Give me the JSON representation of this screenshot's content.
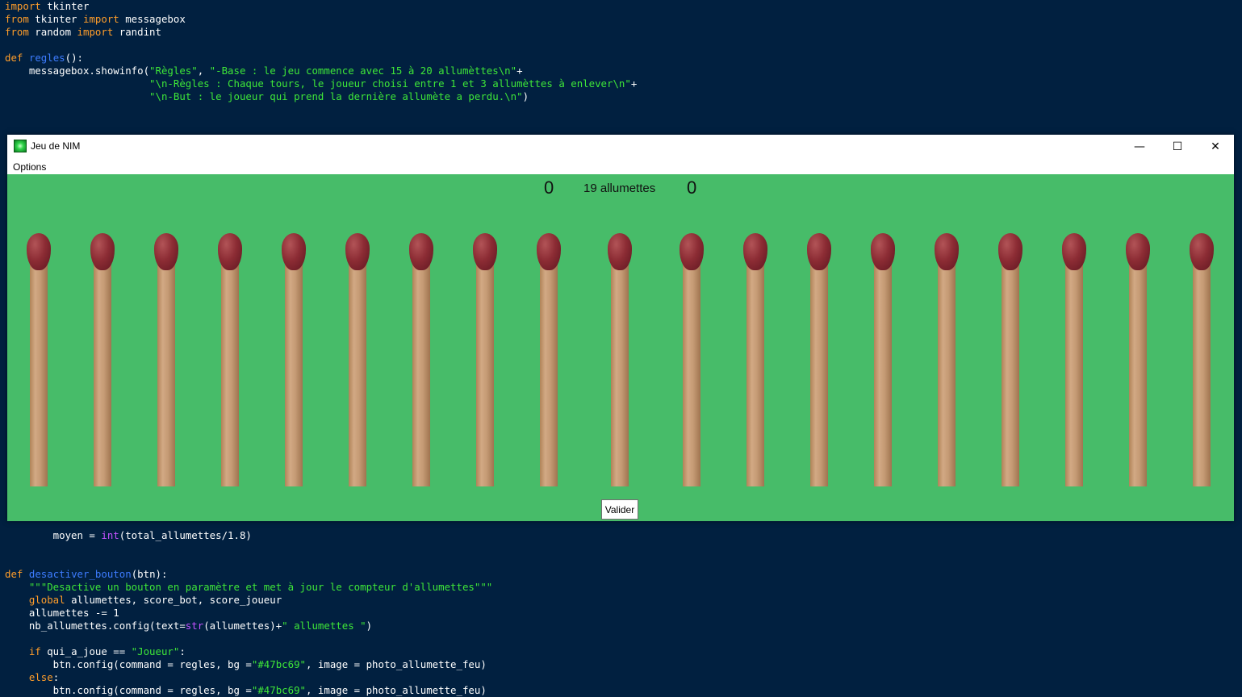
{
  "editor": {
    "top_lines": [
      [
        {
          "t": "import",
          "c": "kw"
        },
        {
          "t": " tkinter",
          "c": ""
        }
      ],
      [
        {
          "t": "from",
          "c": "kw"
        },
        {
          "t": " tkinter ",
          "c": ""
        },
        {
          "t": "import",
          "c": "kw"
        },
        {
          "t": " messagebox",
          "c": ""
        }
      ],
      [
        {
          "t": "from",
          "c": "kw"
        },
        {
          "t": " random ",
          "c": ""
        },
        {
          "t": "import",
          "c": "kw"
        },
        {
          "t": " randint",
          "c": ""
        }
      ],
      [],
      [
        {
          "t": "def",
          "c": "kw"
        },
        {
          "t": " ",
          "c": ""
        },
        {
          "t": "regles",
          "c": "fn"
        },
        {
          "t": "():",
          "c": ""
        }
      ],
      [
        {
          "t": "    messagebox.showinfo(",
          "c": ""
        },
        {
          "t": "\"Règles\"",
          "c": "str"
        },
        {
          "t": ", ",
          "c": ""
        },
        {
          "t": "\"-Base : le jeu commence avec 15 à 20 allumèttes\\n\"",
          "c": "str"
        },
        {
          "t": "+",
          "c": ""
        }
      ],
      [
        {
          "t": "                        ",
          "c": ""
        },
        {
          "t": "\"\\n-Règles : Chaque tours, le joueur choisi entre 1 et 3 allumèttes à enlever\\n\"",
          "c": "str"
        },
        {
          "t": "+",
          "c": ""
        }
      ],
      [
        {
          "t": "                        ",
          "c": ""
        },
        {
          "t": "\"\\n-But : le joueur qui prend la dernière allumète a perdu.\\n\"",
          "c": "str"
        },
        {
          "t": ")",
          "c": ""
        }
      ]
    ],
    "bottom_lines": [
      [],
      [
        {
          "t": "        moyen = ",
          "c": ""
        },
        {
          "t": "int",
          "c": "bi"
        },
        {
          "t": "(total_allumettes/1.8)",
          "c": ""
        }
      ],
      [],
      [],
      [
        {
          "t": "def",
          "c": "kw"
        },
        {
          "t": " ",
          "c": ""
        },
        {
          "t": "desactiver_bouton",
          "c": "fn"
        },
        {
          "t": "(btn):",
          "c": ""
        }
      ],
      [
        {
          "t": "    ",
          "c": ""
        },
        {
          "t": "\"\"\"Desactive un bouton en paramètre et met à jour le compteur d'allumettes\"\"\"",
          "c": "str"
        }
      ],
      [
        {
          "t": "    ",
          "c": ""
        },
        {
          "t": "global",
          "c": "kw"
        },
        {
          "t": " allumettes, score_bot, score_joueur",
          "c": ""
        }
      ],
      [
        {
          "t": "    allumettes -= 1",
          "c": ""
        }
      ],
      [
        {
          "t": "    nb_allumettes.config(text=",
          "c": ""
        },
        {
          "t": "str",
          "c": "bi"
        },
        {
          "t": "(allumettes)+",
          "c": ""
        },
        {
          "t": "\" allumettes \"",
          "c": "str"
        },
        {
          "t": ")",
          "c": ""
        }
      ],
      [],
      [
        {
          "t": "    ",
          "c": ""
        },
        {
          "t": "if",
          "c": "kw"
        },
        {
          "t": " qui_a_joue == ",
          "c": ""
        },
        {
          "t": "\"Joueur\"",
          "c": "str"
        },
        {
          "t": ":",
          "c": ""
        }
      ],
      [
        {
          "t": "        btn.config(command = regles, bg =",
          "c": ""
        },
        {
          "t": "\"#47bc69\"",
          "c": "str"
        },
        {
          "t": ", image = photo_allumette_feu)",
          "c": ""
        }
      ],
      [
        {
          "t": "    ",
          "c": ""
        },
        {
          "t": "else",
          "c": "kw"
        },
        {
          "t": ":",
          "c": ""
        }
      ],
      [
        {
          "t": "        btn.config(command = regles, bg =",
          "c": ""
        },
        {
          "t": "\"#47bc69\"",
          "c": "str"
        },
        {
          "t": ", image = photo_allumette_feu)",
          "c": ""
        }
      ]
    ]
  },
  "window": {
    "title": "Jeu de NIM",
    "menu": [
      "Options"
    ],
    "controls": {
      "minimize": "—",
      "maximize": "☐",
      "close": "✕"
    }
  },
  "game": {
    "score_left": "0",
    "count_label": "19 allumettes",
    "score_right": "0",
    "match_count": 19,
    "valider_label": "Valider",
    "background_color": "#47bc69"
  }
}
